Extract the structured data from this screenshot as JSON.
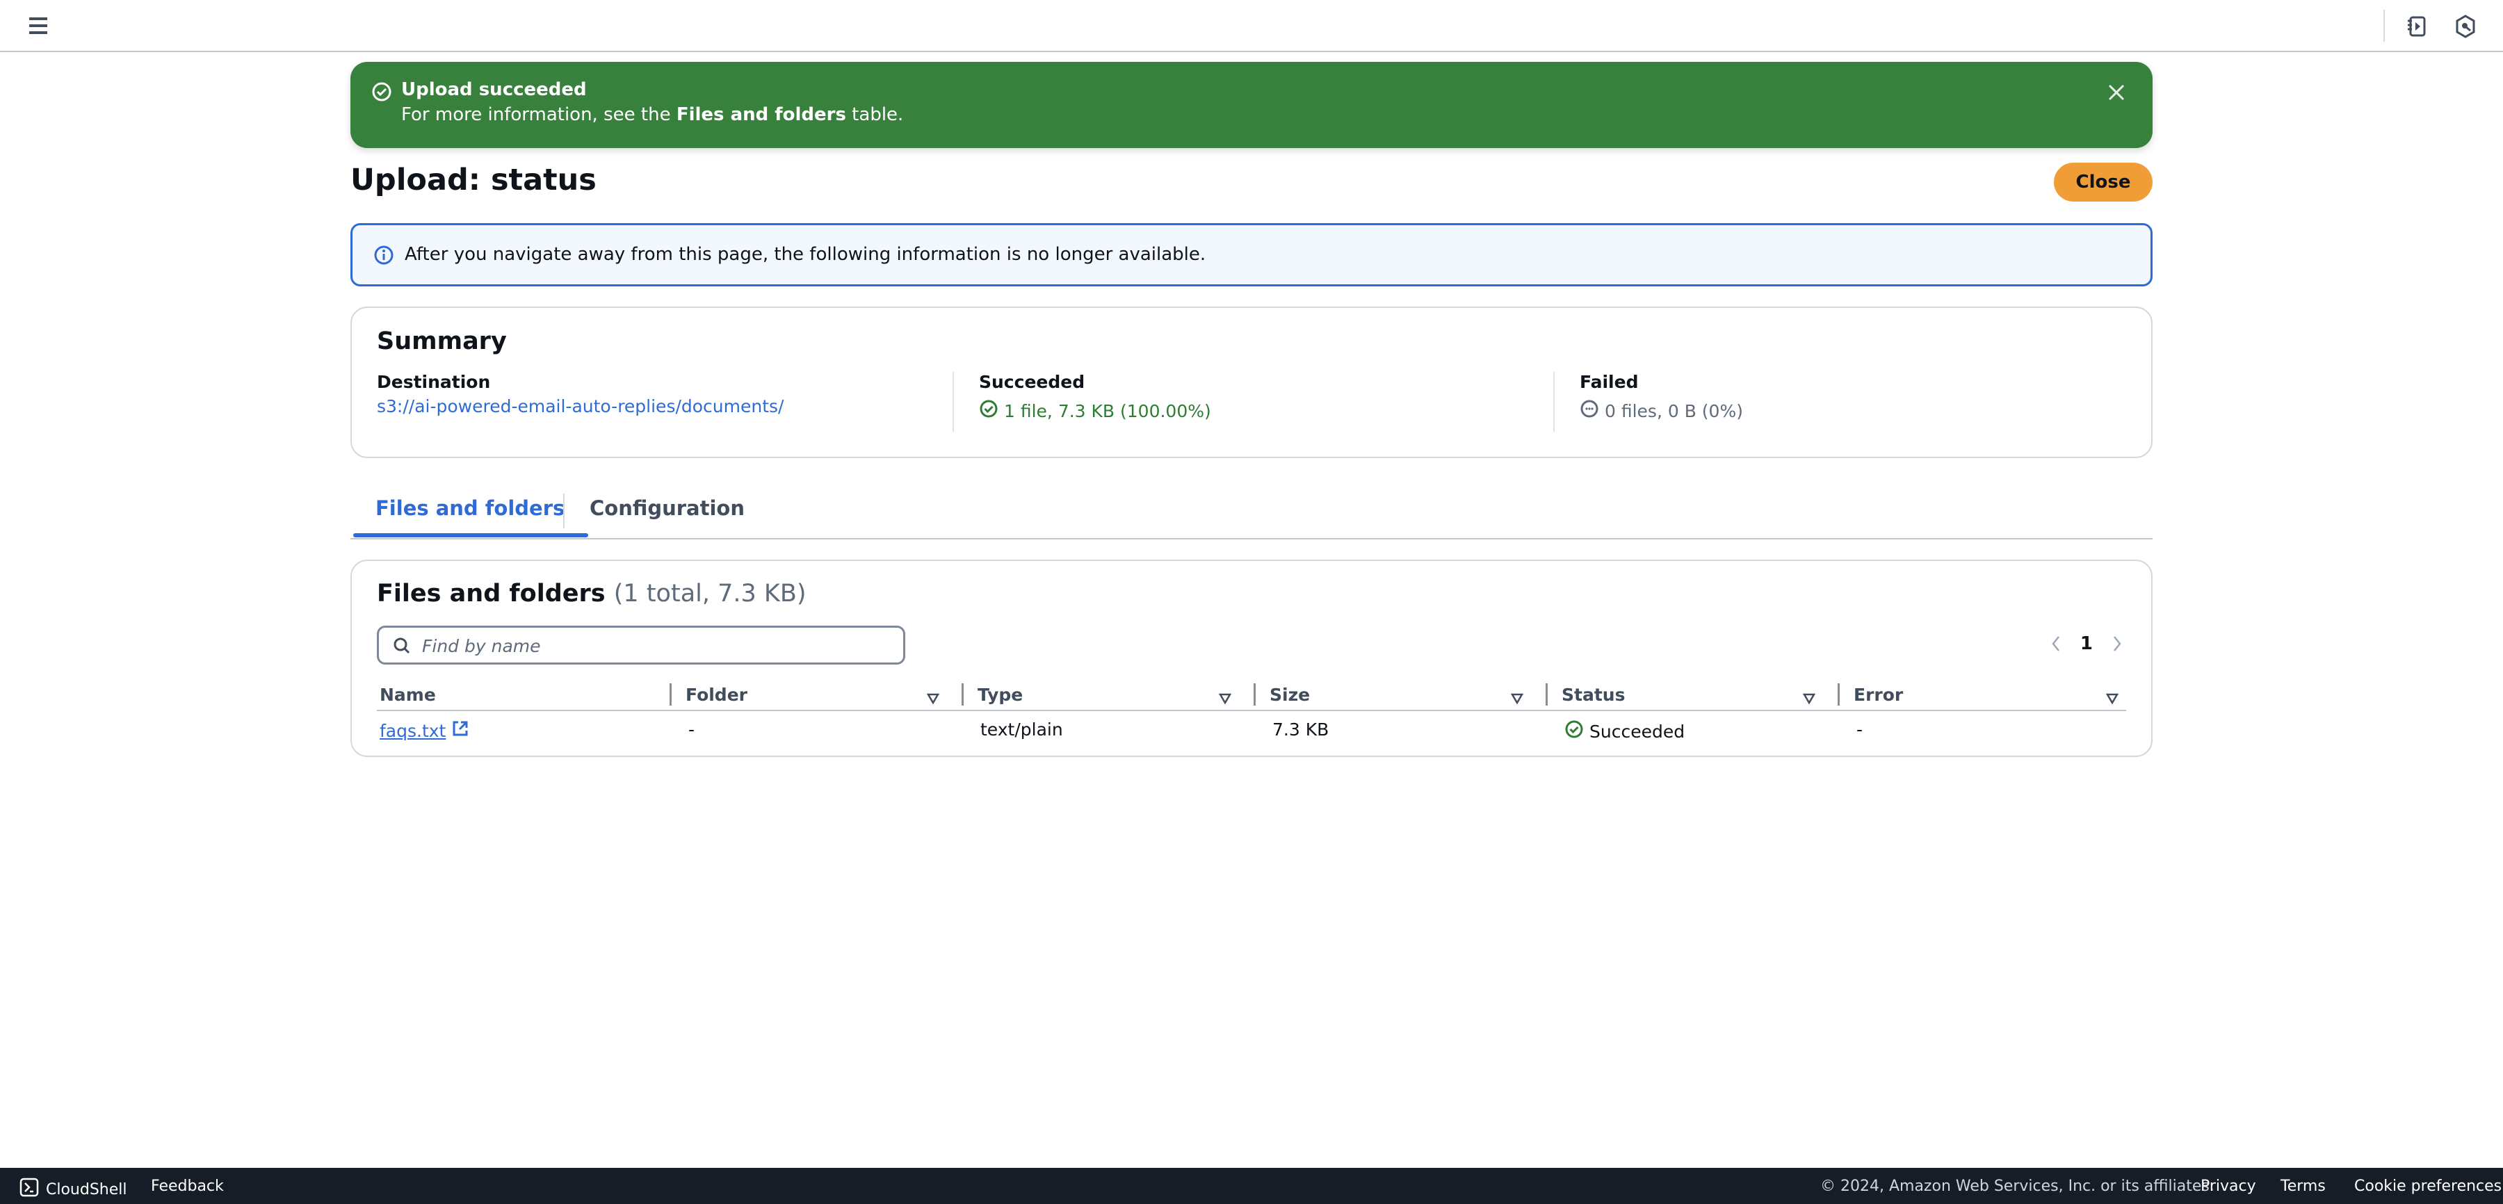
{
  "header": {
    "menu_icon": "hamburger-icon",
    "right_icons": [
      "notebook-play-icon",
      "hexagon-search-icon"
    ]
  },
  "flash": {
    "icon": "check-circle-icon",
    "title": "Upload succeeded",
    "body_prefix": "For more information, see the ",
    "body_bold": "Files and folders",
    "body_suffix": " table.",
    "color": "#37813c"
  },
  "page": {
    "title": "Upload: status",
    "close_label": "Close"
  },
  "info_alert": {
    "icon": "info-circle-icon",
    "text": "After you navigate away from this page, the following information is no longer available."
  },
  "summary": {
    "title": "Summary",
    "destination_label": "Destination",
    "destination_value": "s3://ai-powered-email-auto-replies/documents/",
    "succeeded_label": "Succeeded",
    "succeeded_value": "1 file, 7.3 KB (100.00%)",
    "failed_label": "Failed",
    "failed_value": "0 files, 0 B (0%)"
  },
  "tabs": [
    {
      "label": "Files and folders",
      "active": true
    },
    {
      "label": "Configuration",
      "active": false
    }
  ],
  "files": {
    "title": "Files and folders",
    "count": "(1 total, 7.3 KB)",
    "search_placeholder": "Find by name",
    "search_value": "",
    "page": "1",
    "columns": [
      "Name",
      "Folder",
      "Type",
      "Size",
      "Status",
      "Error"
    ],
    "rows": [
      {
        "name": "faqs.txt",
        "folder": "-",
        "type": "text/plain",
        "size": "7.3 KB",
        "status": "Succeeded",
        "error": "-"
      }
    ]
  },
  "footer": {
    "cloudshell": "CloudShell",
    "feedback": "Feedback",
    "copyright": "© 2024, Amazon Web Services, Inc. or its affiliates.",
    "privacy": "Privacy",
    "terms": "Terms",
    "cookie": "Cookie preferences"
  }
}
